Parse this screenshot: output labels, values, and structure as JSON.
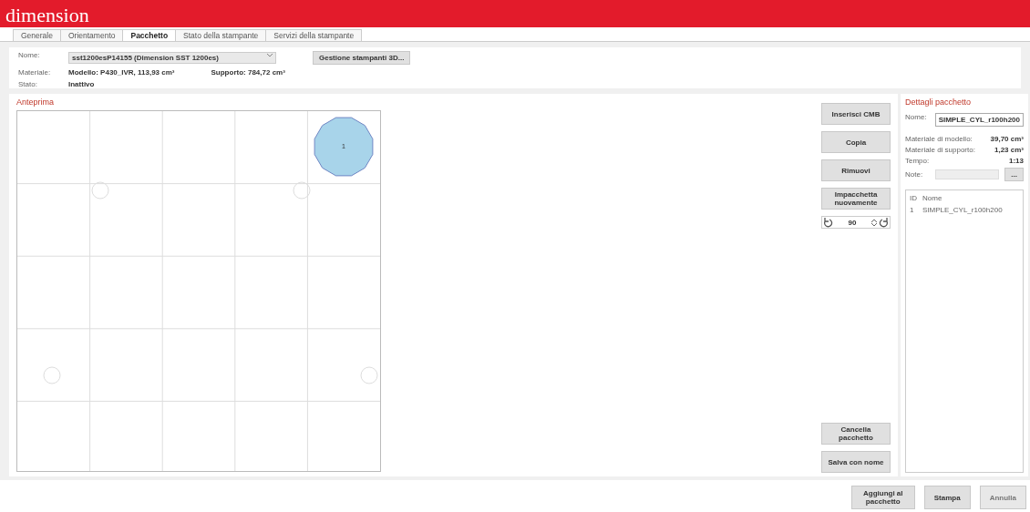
{
  "app": {
    "logo": "dimension"
  },
  "tabs": [
    {
      "label": "Generale",
      "selected": false
    },
    {
      "label": "Orientamento",
      "selected": false
    },
    {
      "label": "Pacchetto",
      "selected": true
    },
    {
      "label": "Stato della stampante",
      "selected": false
    },
    {
      "label": "Servizi della stampante",
      "selected": false
    }
  ],
  "printer": {
    "name_label": "Nome:",
    "name_value": "sst1200esP14155 (Dimension SST 1200es)",
    "manage_button": "Gestione stampanti 3D...",
    "material_label": "Materiale:",
    "model_material": "Modello: P430_IVR, 113,93 cm³",
    "support_material": "Supporto: 784,72 cm³",
    "status_label": "Stato:",
    "status_value": "Inattivo"
  },
  "preview": {
    "title": "Anteprima",
    "parts": [
      {
        "label": "1"
      }
    ]
  },
  "actions": {
    "buttons": [
      {
        "label": "Inserisci CMB"
      },
      {
        "label": "Copia"
      },
      {
        "label": "Rimuovi"
      },
      {
        "label": "Impacchetta nuovamente"
      }
    ],
    "rotation": "90",
    "bottom_buttons": [
      {
        "label": "Cancella pacchetto"
      },
      {
        "label": "Salva con nome"
      }
    ]
  },
  "details": {
    "title": "Dettagli pacchetto",
    "name_label": "Nome:",
    "name_value": "SIMPLE_CYL_r100h200",
    "rows": [
      {
        "label": "Materiale di modello:",
        "value": "39,70 cm³"
      },
      {
        "label": "Materiale di supporto:",
        "value": "1,23 cm³"
      },
      {
        "label": "Tempo:",
        "value": "1:13"
      }
    ],
    "notes_label": "Note:",
    "notes_button": "...",
    "columns": [
      "ID",
      "Nome"
    ],
    "items": [
      {
        "id": "1",
        "name": "SIMPLE_CYL_r100h200"
      }
    ]
  },
  "footer": [
    {
      "label": "Aggiungi al pacchetto",
      "disabled": false
    },
    {
      "label": "Stampa",
      "disabled": false
    },
    {
      "label": "Annulla",
      "disabled": true
    }
  ]
}
